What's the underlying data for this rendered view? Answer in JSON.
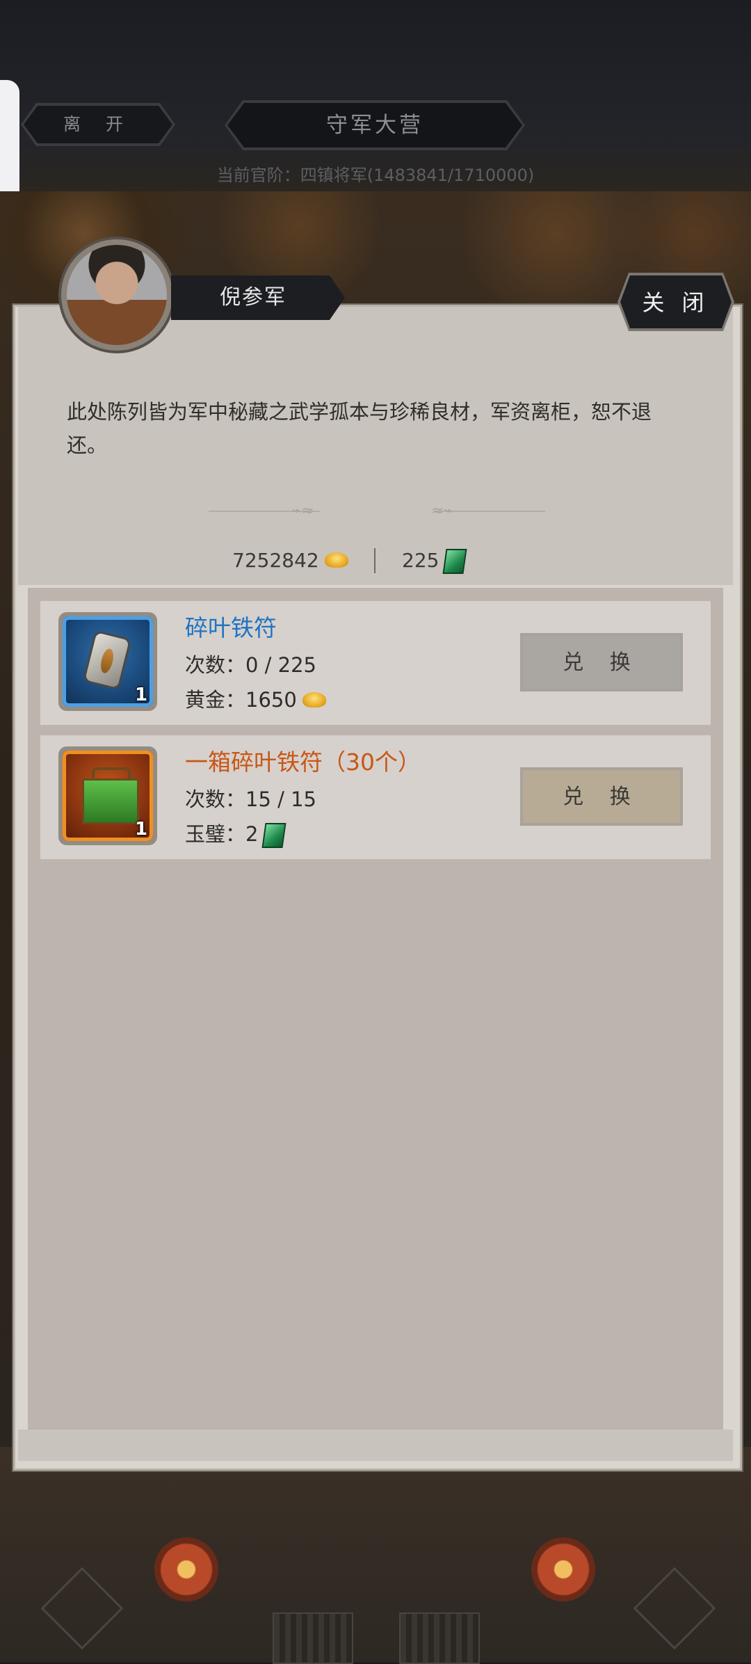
{
  "header": {
    "leave_label": "离 开",
    "camp_title": "守军大营",
    "rank_text": "当前官阶：四镇将军(1483841/1710000)"
  },
  "dialog": {
    "npc_name": "倪参军",
    "close_label": "关 闭",
    "description": "此处陈列皆为军中秘藏之武学孤本与珍稀良材，军资离柜，恕不退还。",
    "gold_amount": "7252842",
    "jade_amount": "225",
    "items": [
      {
        "name": "碎叶铁符",
        "quantity": "1",
        "count_text": "次数：0 / 225",
        "price_text": "黄金：1650",
        "price_currency": "gold-ingot-icon",
        "button_label": "兑 换",
        "rarity_color": "#1f73c4",
        "button_state": "disabled"
      },
      {
        "name": "一箱碎叶铁符（30个）",
        "quantity": "1",
        "count_text": "次数：15 / 15",
        "price_text": "玉璧：2",
        "price_currency": "jade-icon",
        "button_label": "兑 换",
        "rarity_color": "#c85616",
        "button_state": "active"
      }
    ]
  }
}
